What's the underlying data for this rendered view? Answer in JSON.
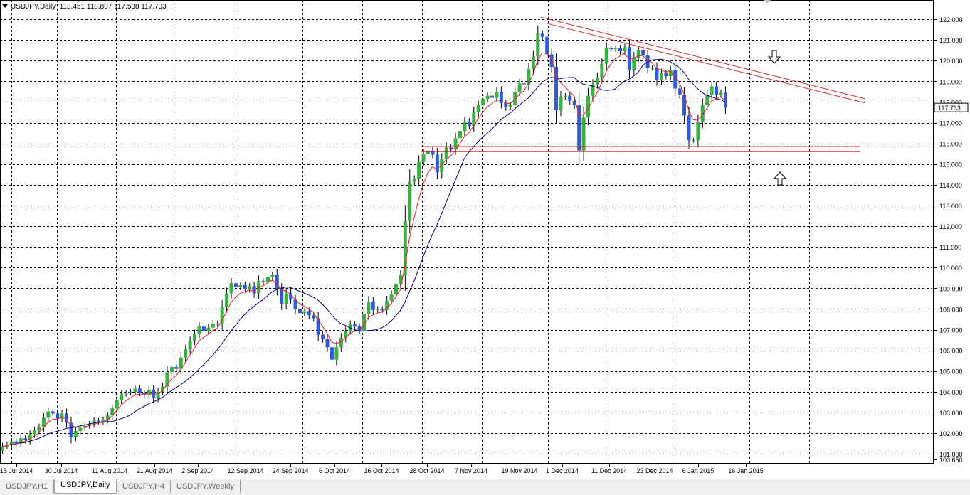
{
  "header": {
    "symbol": "USDJPY,Daily",
    "ohlc": "118.451 118.807 117.538 117.733"
  },
  "tabs": [
    {
      "label": "USDJPY,H1",
      "active": false
    },
    {
      "label": "USDJPY,Daily",
      "active": true
    },
    {
      "label": "USDJPY,H4",
      "active": false
    },
    {
      "label": "USDJPY,Weekly",
      "active": false
    }
  ],
  "colors": {
    "bull": "#3cb043",
    "bear": "#2f5bd8",
    "wick": "#000000",
    "ma_fast": "#e02020",
    "ma_slow": "#000080",
    "trendline": "#d03030",
    "grid": "#000000",
    "background": "#ffffff"
  },
  "annotations": [
    {
      "type": "arrow",
      "direction": "down",
      "icon": "down-arrow-icon"
    },
    {
      "type": "arrow",
      "direction": "up",
      "icon": "up-arrow-icon"
    }
  ],
  "chart_data": {
    "type": "candlestick",
    "symbol": "USDJPY",
    "timeframe": "Daily",
    "y_range": [
      100.65,
      122.5
    ],
    "price_axis_labels": [
      "122.000",
      "121.000",
      "120.000",
      "119.000",
      "118.000",
      "117.000",
      "116.000",
      "115.000",
      "114.000",
      "113.000",
      "112.000",
      "111.000",
      "110.000",
      "109.000",
      "108.000",
      "107.000",
      "106.000",
      "105.000",
      "104.000",
      "103.000",
      "102.000",
      "101.000",
      "100.650"
    ],
    "current_price": "117.733",
    "date_labels": [
      "18 Jul 2014",
      "30 Jul 2014",
      "11 Aug 2014",
      "21 Aug 2014",
      "2 Sep 2014",
      "12 Sep 2014",
      "24 Sep 2014",
      "6 Oct 2014",
      "16 Oct 2014",
      "28 Oct 2014",
      "7 Nov 2014",
      "19 Nov 2014",
      "1 Dec 2014",
      "11 Dec 2014",
      "23 Dec 2014",
      "6 Jan 2015",
      "16 Jan 2015"
    ],
    "closes": [
      101.35,
      101.45,
      101.6,
      101.5,
      101.75,
      101.65,
      101.95,
      102.15,
      102.3,
      102.75,
      103.05,
      102.95,
      102.7,
      102.95,
      102.5,
      101.8,
      102.1,
      102.25,
      102.35,
      102.45,
      102.6,
      102.55,
      102.65,
      102.85,
      103.2,
      103.6,
      103.9,
      103.95,
      104.0,
      104.15,
      103.95,
      103.85,
      104.1,
      103.7,
      104.0,
      104.25,
      104.95,
      105.2,
      105.1,
      105.65,
      106.05,
      106.45,
      106.8,
      107.15,
      106.95,
      107.1,
      107.3,
      107.25,
      108.1,
      108.75,
      109.25,
      109.05,
      109.15,
      108.95,
      109.1,
      108.75,
      109.35,
      109.3,
      109.55,
      109.65,
      108.95,
      108.25,
      108.75,
      108.45,
      108.0,
      107.8,
      107.9,
      107.7,
      107.55,
      106.75,
      106.55,
      106.15,
      105.55,
      106.15,
      106.6,
      106.95,
      107.25,
      107.15,
      106.95,
      107.75,
      108.35,
      107.95,
      108.0,
      107.95,
      108.4,
      108.7,
      109.2,
      109.65,
      112.25,
      114.15,
      114.3,
      115.1,
      115.5,
      115.65,
      115.45,
      114.6,
      115.25,
      115.8,
      115.7,
      116.25,
      116.6,
      117.05,
      116.85,
      117.5,
      117.85,
      118.15,
      118.3,
      118.2,
      118.5,
      117.95,
      117.75,
      117.85,
      118.5,
      118.9,
      118.85,
      119.6,
      120.2,
      121.3,
      121.15,
      120.3,
      119.7,
      117.6,
      118.25,
      118.3,
      118.05,
      117.85,
      115.65,
      117.25,
      118.3,
      118.85,
      119.2,
      119.85,
      120.6,
      120.55,
      120.6,
      120.45,
      120.65,
      119.55,
      120.15,
      120.5,
      120.25,
      119.65,
      119.65,
      119.05,
      119.4,
      119.25,
      119.55,
      118.65,
      118.35,
      117.35,
      116.15,
      116.15,
      117.05,
      117.85,
      118.35,
      118.75,
      118.35,
      118.45,
      117.73
    ],
    "moving_averages": [
      {
        "period": "fast",
        "color": "red"
      },
      {
        "period": "slow",
        "color": "navy"
      }
    ],
    "trendlines": [
      {
        "kind": "resistance-descending",
        "from": [
          121.95,
          "1 Dec 2014"
        ],
        "to": [
          118.15,
          "after 16 Jan 2015"
        ]
      },
      {
        "kind": "support-horizontal",
        "price": 115.6
      },
      {
        "kind": "support-horizontal",
        "price": 115.85
      }
    ],
    "grid": true
  }
}
